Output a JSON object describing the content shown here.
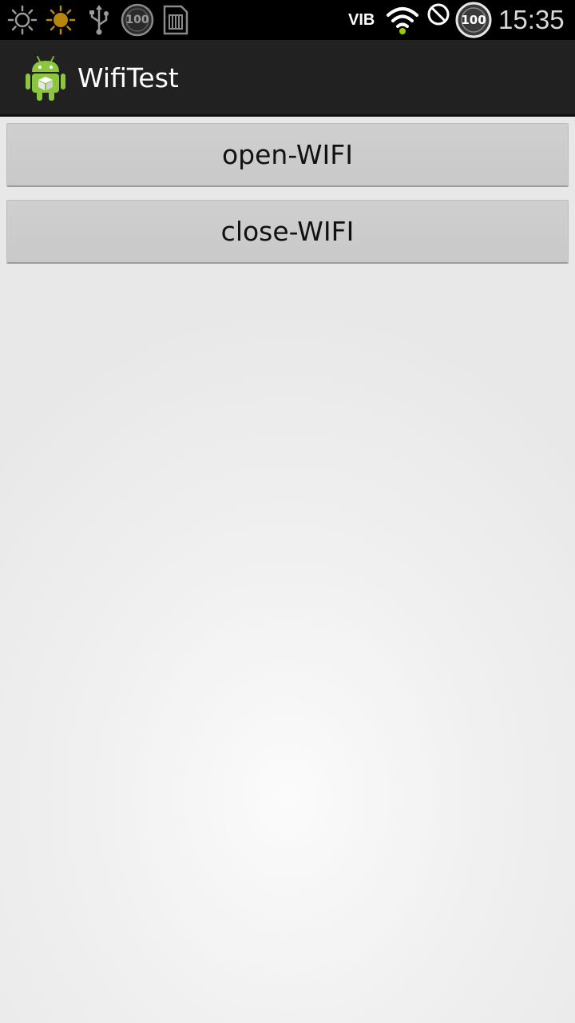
{
  "status_bar": {
    "carrier": "VIB",
    "time": "15:35",
    "badge_left": "100",
    "badge_right": "100",
    "icons": [
      "brightness-outline-icon",
      "brightness-filled-icon",
      "usb-icon",
      "badge-100-icon",
      "sd-card-icon",
      "wifi-icon",
      "blocked-icon",
      "badge-100-icon"
    ]
  },
  "action_bar": {
    "title": "WifiTest",
    "logo_icon": "android-icon"
  },
  "buttons": {
    "open": "open-WIFI",
    "close": "close-WIFI"
  },
  "colors": {
    "status_bar_bg": "#000000",
    "action_bar_bg": "#212121",
    "button_bg": "#cccccc",
    "content_bg": "#ebebeb"
  }
}
